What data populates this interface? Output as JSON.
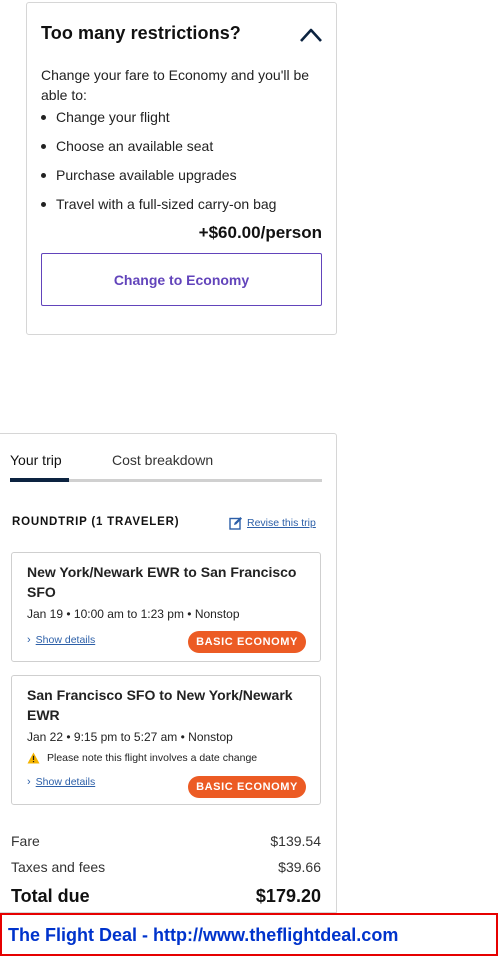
{
  "restrictions": {
    "title": "Too many restrictions?",
    "toggle_icon": "chevron-up-icon",
    "intro": "Change your fare to Economy and you'll be able to:",
    "benefits": [
      "Change your flight",
      "Choose an available seat",
      "Purchase available upgrades",
      "Travel with a full-sized carry-on bag"
    ],
    "price": "+$60.00/person",
    "button_label": "Change to Economy",
    "accent_color": "#6244bb"
  },
  "trip": {
    "tabs": [
      "Your trip",
      "Cost breakdown"
    ],
    "active_tab": "Your trip",
    "roundtrip_label": "ROUNDTRIP (1 TRAVELER)",
    "revise_label": "Revise this trip",
    "flights": [
      {
        "route": "New York/Newark EWR to San Francisco SFO",
        "times": "Jan 19 • 10:00 am to 1:23 pm • Nonstop",
        "details_label": "Show details",
        "badge": "BASIC ECONOMY"
      },
      {
        "route": "San Francisco SFO to New York/Newark EWR",
        "times": "Jan 22 • 9:15 pm to 5:27 am • Nonstop",
        "note": "Please note this flight involves a date change",
        "details_label": "Show details",
        "badge": "BASIC ECONOMY"
      }
    ],
    "costs": {
      "fare_label": "Fare",
      "fare_value": "$139.54",
      "taxes_label": "Taxes and fees",
      "taxes_value": "$39.66",
      "total_label": "Total due",
      "total_value": "$179.20"
    },
    "badge_color": "#ec5b24",
    "link_color": "#2c5fa8"
  },
  "banner": {
    "text": "The Flight Deal - http://www.theflightdeal.com",
    "border_color": "#e60000",
    "text_color": "#0033cc"
  }
}
